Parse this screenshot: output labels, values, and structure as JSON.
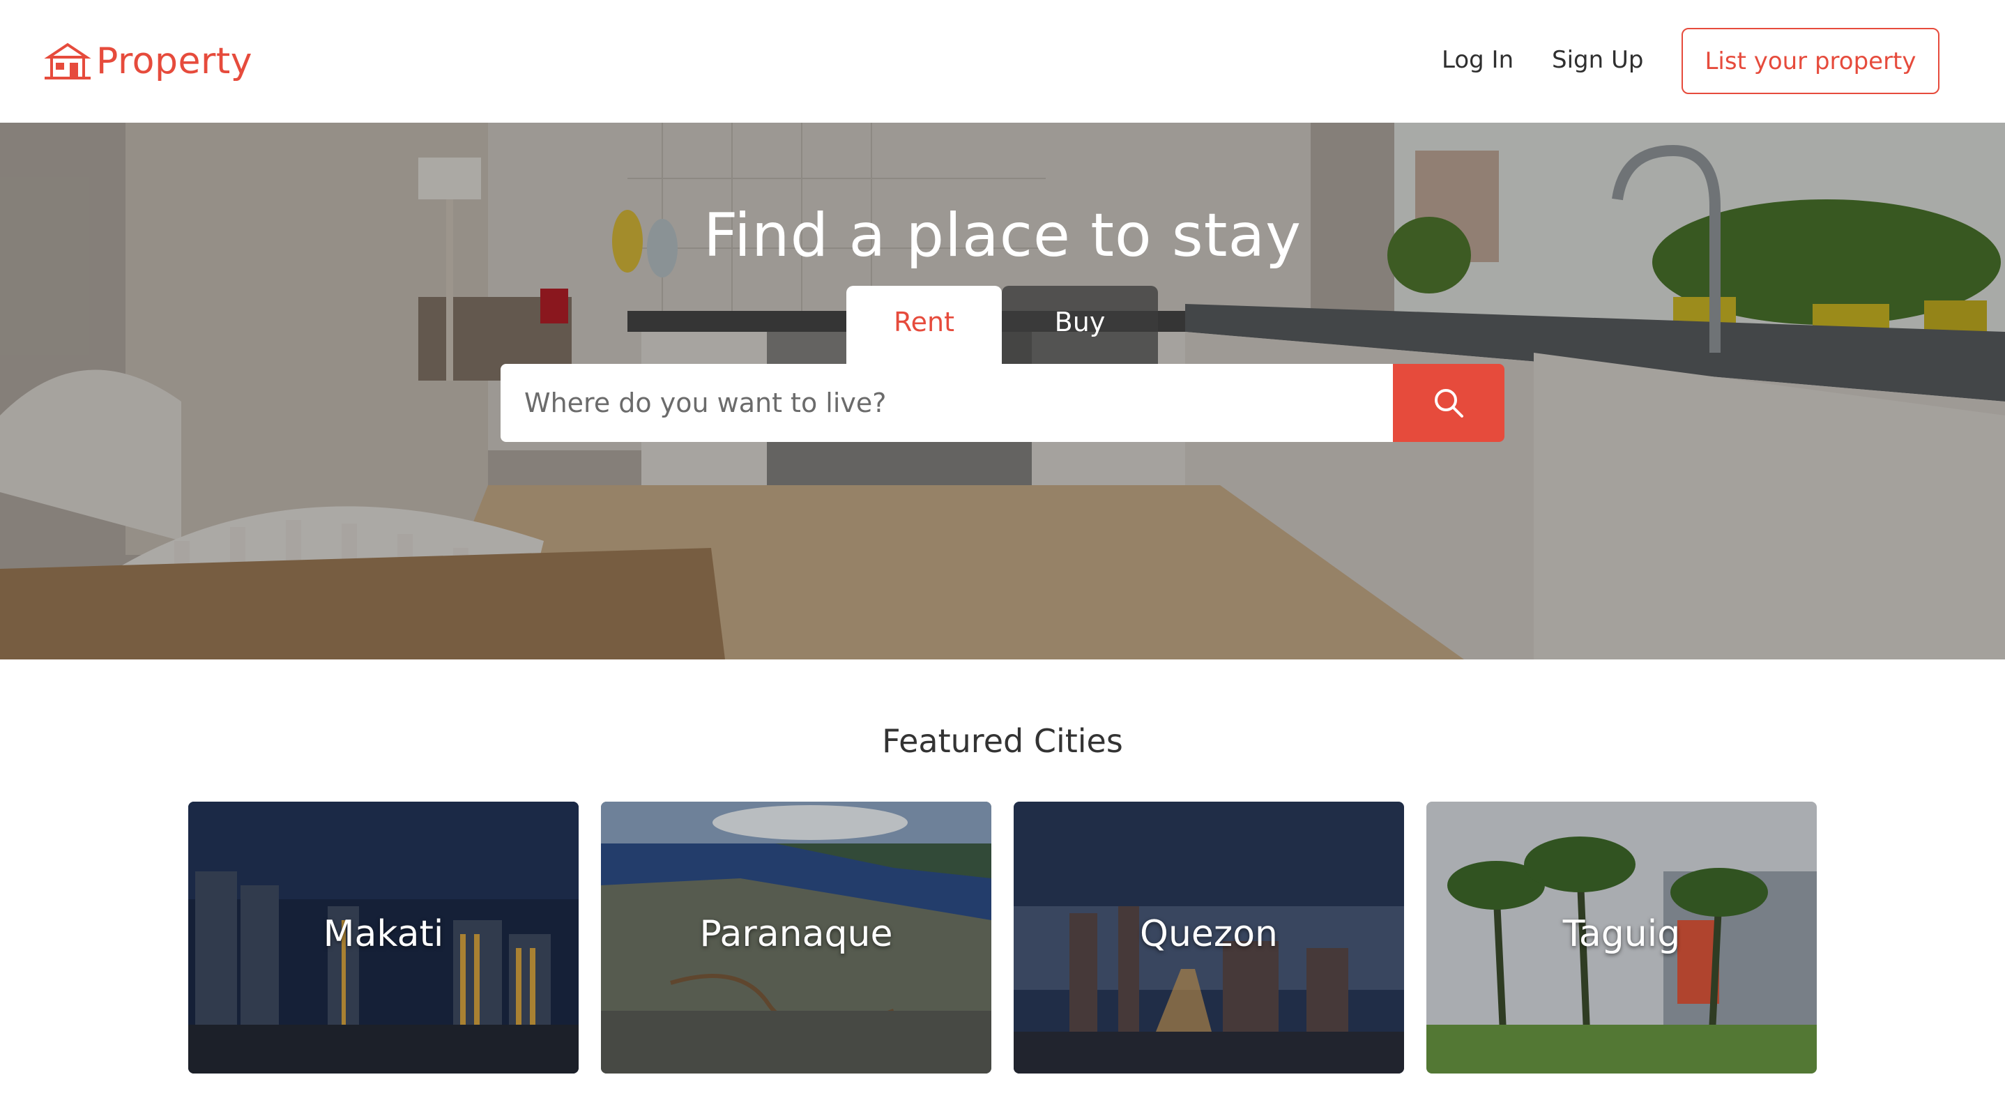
{
  "header": {
    "logo_text": "Property",
    "nav": {
      "login": "Log In",
      "signup": "Sign Up"
    },
    "cta": "List your property"
  },
  "hero": {
    "title": "Find a place to stay",
    "tabs": [
      {
        "label": "Rent",
        "active": true
      },
      {
        "label": "Buy",
        "active": false
      }
    ],
    "search": {
      "placeholder": "Where do you want to live?"
    }
  },
  "featured": {
    "title": "Featured Cities",
    "cities": [
      {
        "name": "Makati"
      },
      {
        "name": "Paranaque"
      },
      {
        "name": "Quezon"
      },
      {
        "name": "Taguig"
      }
    ]
  },
  "colors": {
    "accent": "#e64b3c"
  },
  "icons": {
    "logo": "house-icon",
    "search": "search-icon"
  }
}
